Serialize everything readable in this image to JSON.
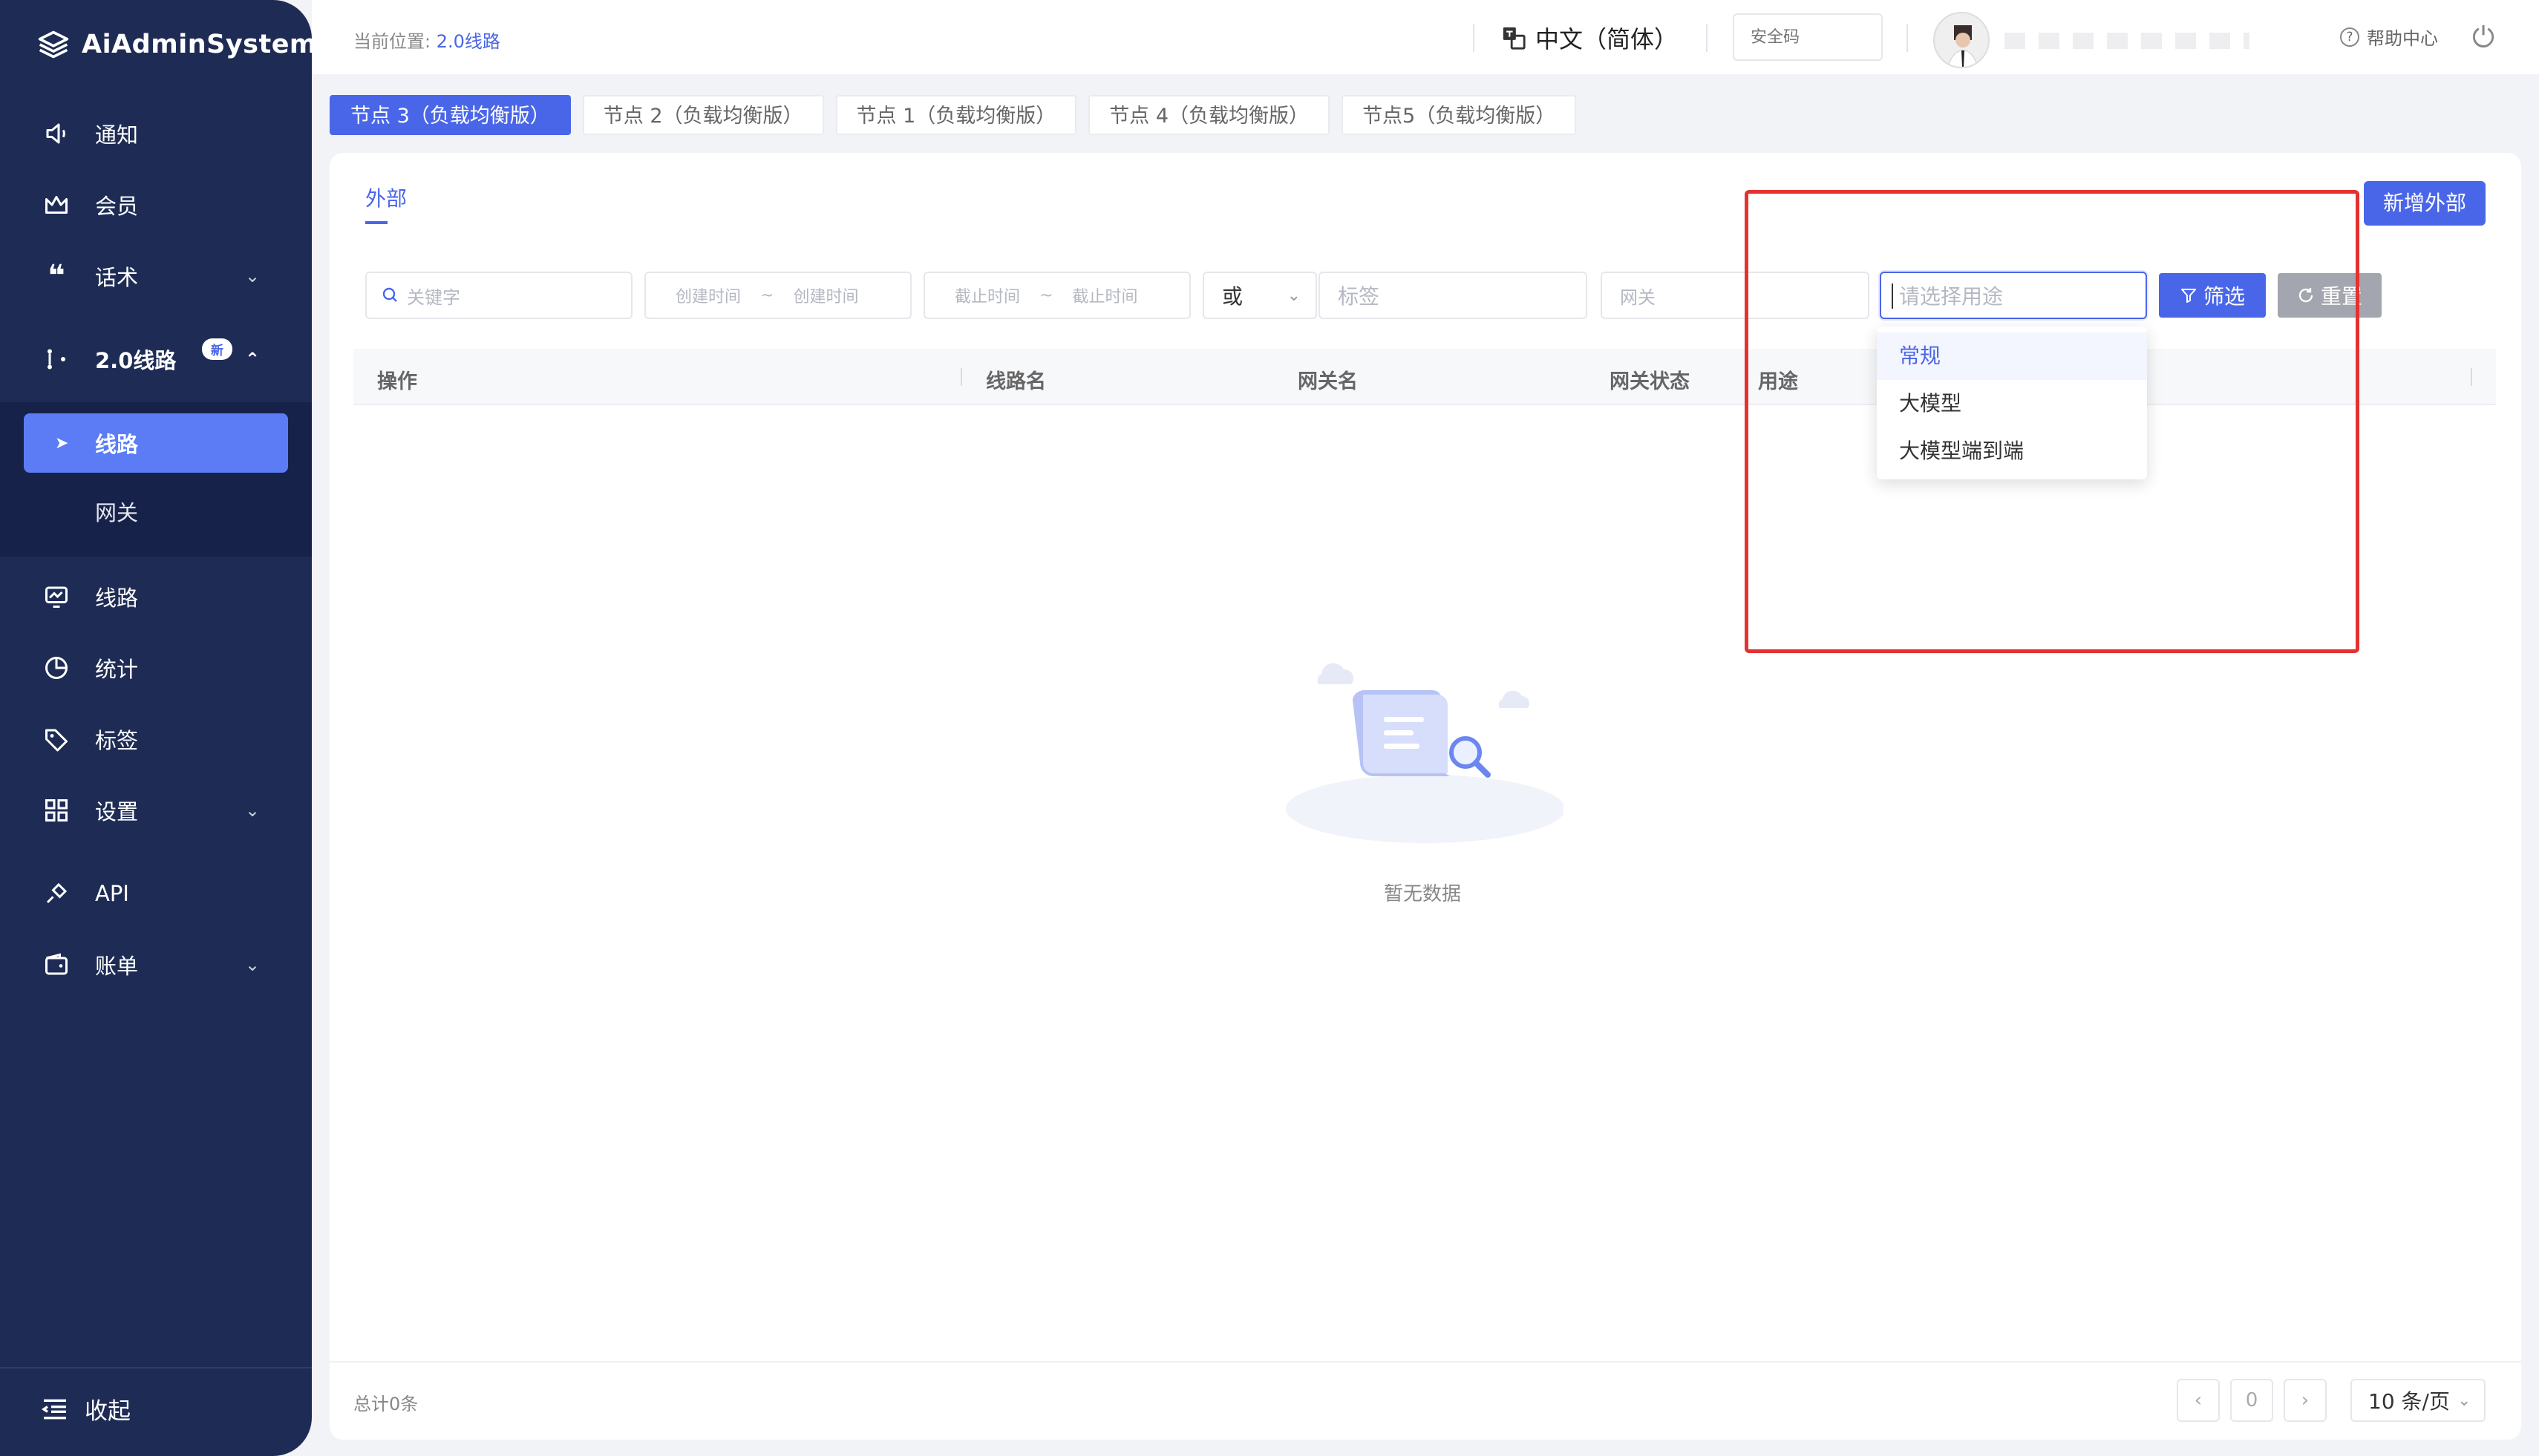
{
  "app": {
    "name": "AiAdminSystem"
  },
  "sidebar": {
    "items": [
      {
        "label": "通知",
        "icon": "speaker-icon"
      },
      {
        "label": "会员",
        "icon": "crown-icon"
      },
      {
        "label": "话术",
        "icon": "quote-icon",
        "expandable": true
      },
      {
        "label": "2.0线路",
        "icon": "route-icon",
        "badge": "新",
        "expanded": true
      },
      {
        "label": "线路",
        "icon": "monitor-icon"
      },
      {
        "label": "统计",
        "icon": "pie-chart-icon"
      },
      {
        "label": "标签",
        "icon": "tag-icon"
      },
      {
        "label": "设置",
        "icon": "grid-icon",
        "expandable": true
      },
      {
        "label": "API",
        "icon": "plug-icon"
      },
      {
        "label": "账单",
        "icon": "wallet-icon",
        "expandable": true
      }
    ],
    "sub_items": [
      {
        "label": "线路",
        "active": true
      },
      {
        "label": "网关",
        "active": false
      }
    ],
    "collapse_label": "收起"
  },
  "header": {
    "breadcrumb_prefix": "当前位置:",
    "breadcrumb_current": "2.0线路",
    "language": "中文（简体）",
    "security_placeholder": "安全码",
    "help": "帮助中心"
  },
  "node_tabs": [
    {
      "label": "节点 3（负载均衡版）",
      "active": true
    },
    {
      "label": "节点 2（负载均衡版）",
      "active": false
    },
    {
      "label": "节点 1（负载均衡版）",
      "active": false
    },
    {
      "label": "节点 4（负载均衡版）",
      "active": false
    },
    {
      "label": "节点5（负载均衡版）",
      "active": false
    }
  ],
  "main": {
    "tab": "外部",
    "add_button": "新增外部",
    "filters": {
      "keyword_placeholder": "关键字",
      "created_start": "创建时间",
      "created_end": "创建时间",
      "expire_start": "截止时间",
      "expire_end": "截止时间",
      "range_sep": "~",
      "logic_value": "或",
      "tag_placeholder": "标签",
      "gateway_placeholder": "网关",
      "usage_placeholder": "请选择用途"
    },
    "filter_button": "筛选",
    "reset_button": "重置",
    "columns": [
      "操作",
      "线路名",
      "网关名",
      "网关状态",
      "用途"
    ],
    "usage_options": [
      "常规",
      "大模型",
      "大模型端到端"
    ],
    "empty_text": "暂无数据",
    "total": "总计0条",
    "page": "0",
    "page_size": "10 条/页"
  },
  "colors": {
    "primary": "#4a66e8",
    "sidebar": "#1e2c55",
    "highlight": "#e3322f"
  }
}
